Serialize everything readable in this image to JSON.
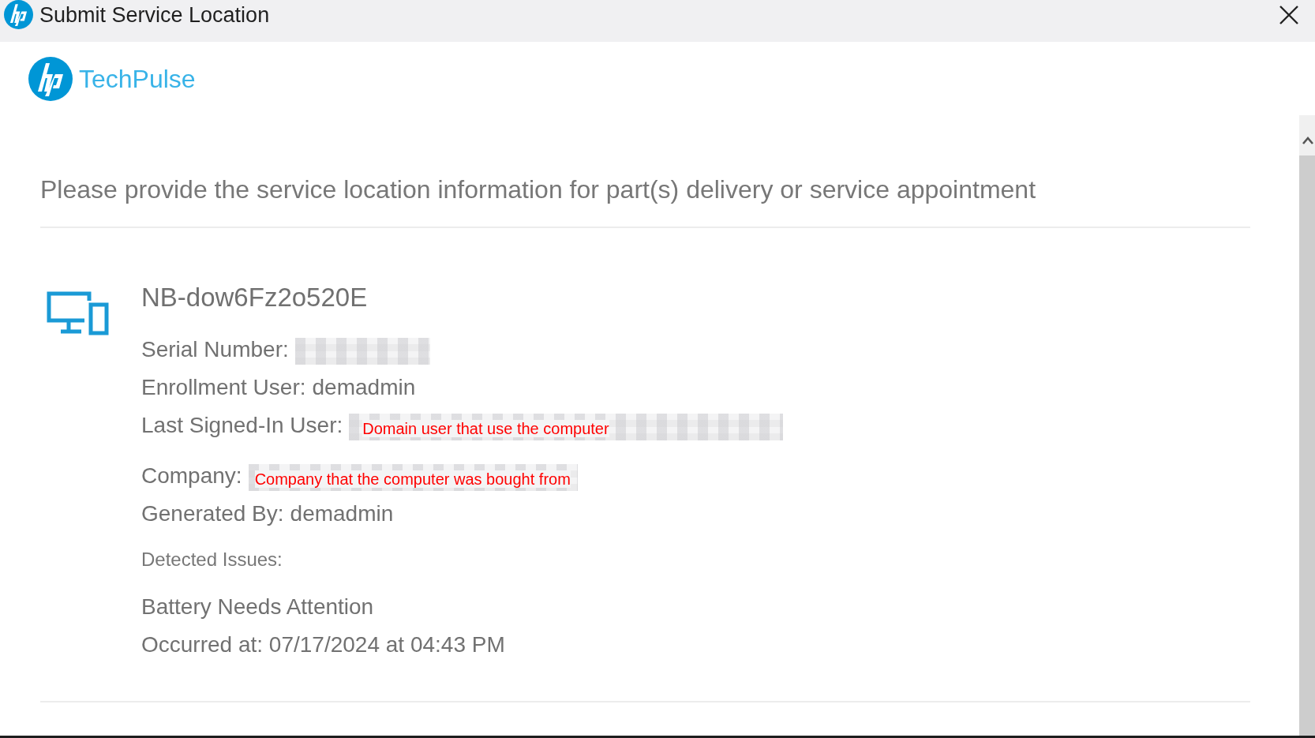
{
  "window": {
    "title": "Submit Service Location"
  },
  "brand": {
    "name": "TechPulse"
  },
  "heading": "Please provide the service location information for part(s) delivery or service appointment",
  "device": {
    "name": "NB-dow6Fz2o520E",
    "fields": [
      {
        "kind": "redacted",
        "label": "Serial Number:"
      },
      {
        "kind": "text",
        "label": "Enrollment User:",
        "value": "demadmin"
      },
      {
        "kind": "redacted",
        "label": "Last Signed-In User:",
        "annotation": "Domain user that use the computer"
      },
      {
        "kind": "redacted",
        "label": "Company:",
        "annotation": "Company that the computer was bought from"
      },
      {
        "kind": "text",
        "label": "Generated By:",
        "value": "demadmin"
      }
    ],
    "issues_label": "Detected Issues:",
    "issues": [
      {
        "title": "Battery Needs Attention",
        "occurred": "Occurred at: 07/17/2024 at 04:43 PM"
      }
    ]
  }
}
